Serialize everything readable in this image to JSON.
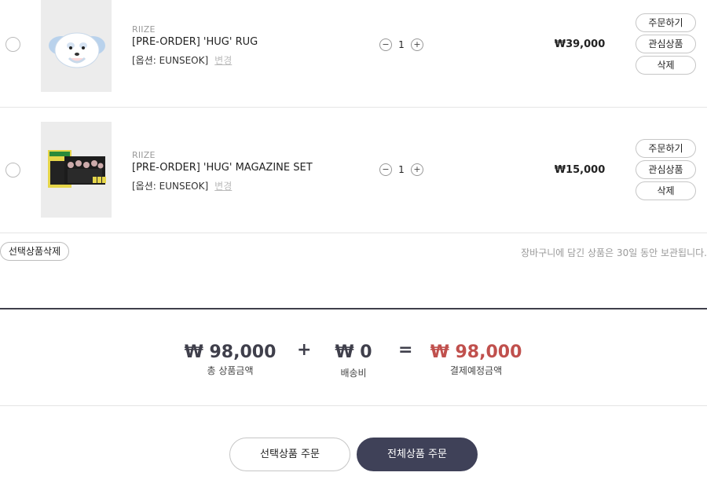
{
  "items": [
    {
      "brand": "RIIZE",
      "name": "[PRE-ORDER] 'HUG' RUG",
      "option": "[옵션: EUNSEOK]",
      "option_change": "변경",
      "qty_minus": "−",
      "quantity": "1",
      "qty_plus": "+",
      "price": "₩39,000",
      "order_label": "주문하기",
      "wish_label": "관심상품",
      "delete_label": "삭제"
    },
    {
      "brand": "RIIZE",
      "name": "[PRE-ORDER] 'HUG' MAGAZINE SET",
      "option": "[옵션: EUNSEOK]",
      "option_change": "변경",
      "qty_minus": "−",
      "quantity": "1",
      "qty_plus": "+",
      "price": "₩15,000",
      "order_label": "주문하기",
      "wish_label": "관심상품",
      "delete_label": "삭제"
    }
  ],
  "cart": {
    "delete_selected": "선택상품삭제",
    "keep_notice": "장바구니에 담긴 상품은 30일 동안 보관됩니다."
  },
  "summary": {
    "total_products_amount": "₩ 98,000",
    "total_products_label": "총 상품금액",
    "plus": "+",
    "shipping_amount": "₩ 0",
    "shipping_label": "배송비",
    "equals": "=",
    "payment_amount": "₩ 98,000",
    "payment_label": "결제예정금액",
    "payment_color": "#c0504d"
  },
  "actions": {
    "order_selected": "선택상품 주문",
    "order_all": "전체상품 주문"
  },
  "colors": {
    "accent_dark": "#3f4158",
    "highlight_red": "#c0504d"
  }
}
